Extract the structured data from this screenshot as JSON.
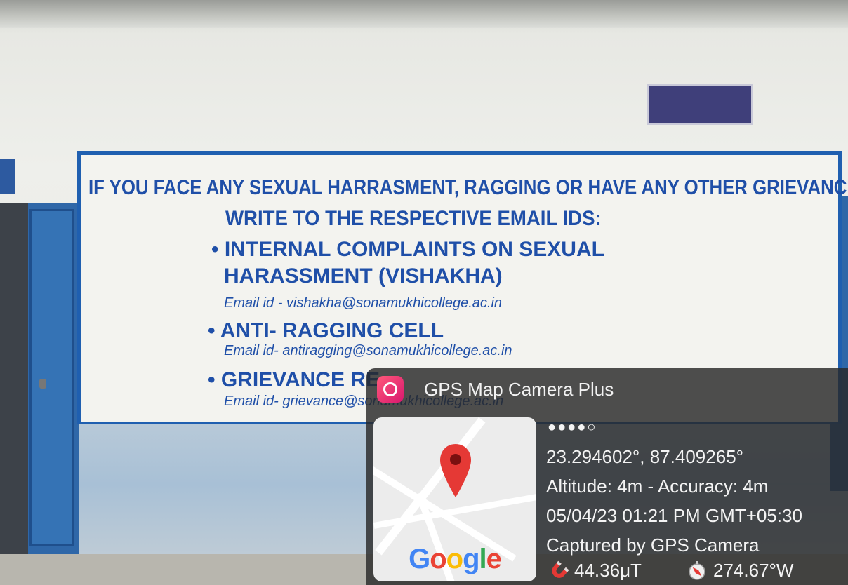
{
  "sign": {
    "heading_line1": "IF YOU FACE ANY SEXUAL HARRASMENT, RAGGING  OR HAVE ANY OTHER GRIEVANCES",
    "heading_line2": "WRITE TO THE RESPECTIVE EMAIL IDS:",
    "item1_line1": "• INTERNAL COMPLAINTS ON SEXUAL",
    "item1_line2": "HARASSMENT (VISHAKHA)",
    "item1_email": "Email id - vishakha@sonamukhicollege.ac.in",
    "item2": "• ANTI- RAGGING CELL",
    "item2_email": "Email id- antiragging@sonamukhicollege.ac.in",
    "item3": "• GRIEVANCE RE",
    "item3_email": "Email id- grievance@sonamukhicollege.ac.in"
  },
  "gps_overlay": {
    "app_name": "GPS Map Camera Plus",
    "signal_dots": "●●●●○",
    "coordinates": "23.294602°, 87.409265°",
    "altitude_accuracy": "Altitude: 4m - Accuracy: 4m",
    "datetime": "05/04/23 01:21 PM GMT+05:30",
    "captured_by": "Captured by GPS Camera",
    "magnetic_field": "44.36μT",
    "compass_heading": "274.67°W",
    "map_brand": "Google",
    "magnet_icon": "magnet-icon",
    "compass_icon": "compass-icon",
    "pin_icon": "map-pin-icon",
    "pin_color": "#e53935"
  }
}
